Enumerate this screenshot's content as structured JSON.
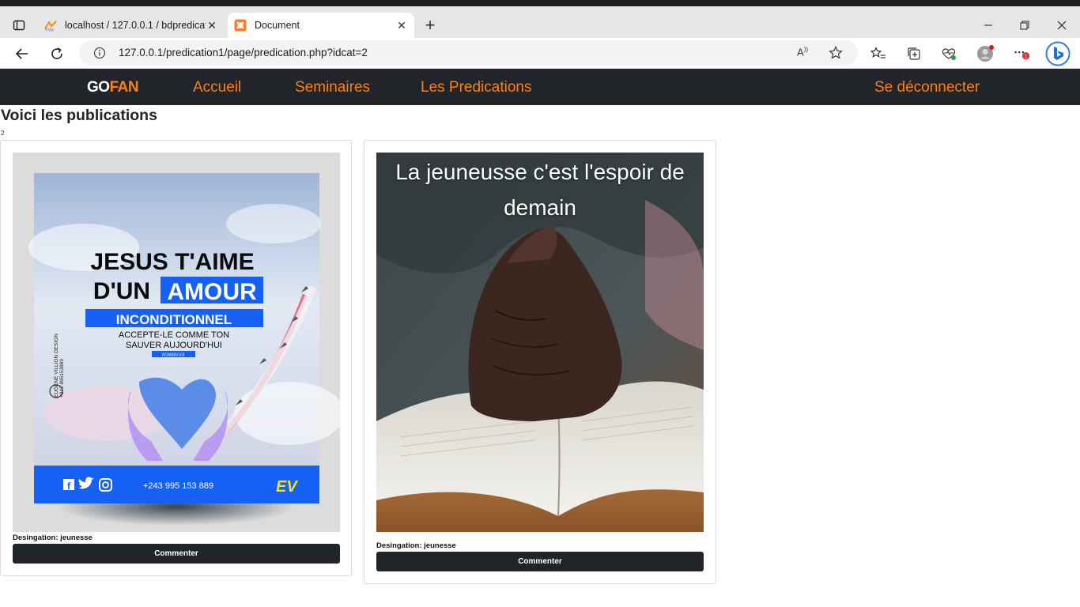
{
  "browser": {
    "tabs": [
      {
        "title": "localhost / 127.0.0.1 / bdpredication",
        "favicon": "phpmyadmin-icon",
        "active": false
      },
      {
        "title": "Document",
        "favicon": "xampp-icon",
        "active": true
      }
    ],
    "url": "127.0.0.1/predication1/page/predication.php?idcat=2",
    "notification_badge": "1"
  },
  "navbar": {
    "brand_a": "GO",
    "brand_b": "FAN",
    "links": [
      "Accueil",
      "Seminaires",
      "Les Predications"
    ],
    "logout": "Se déconnecter",
    "colors": {
      "bg": "#212529",
      "accent": "#fd7e14"
    }
  },
  "main": {
    "title": "Voici les publications",
    "count": "2",
    "cards": [
      {
        "designation": "Desingation: jeunesse",
        "button": "Commenter",
        "poster": {
          "line1": "JESUS T'AIME",
          "line2a": "D'UN",
          "line2b": "AMOUR",
          "line3": "INCONDITIONNEL",
          "line4": "ACCEPTE-LE COMME TON",
          "line5": "SAUVER AUJOURD'HUI",
          "verse": "ROMAIN 5:8",
          "side1": "EUGENE VILLION DESIGN",
          "side2": "+243 995153889",
          "phone": "+243 995 153 889",
          "logo": "EV"
        }
      },
      {
        "designation": "Desingation: jeunesse",
        "button": "Commenter",
        "overlay_line1": "La jeuneusse c'est l'espoir de",
        "overlay_line2": "demain"
      }
    ]
  }
}
